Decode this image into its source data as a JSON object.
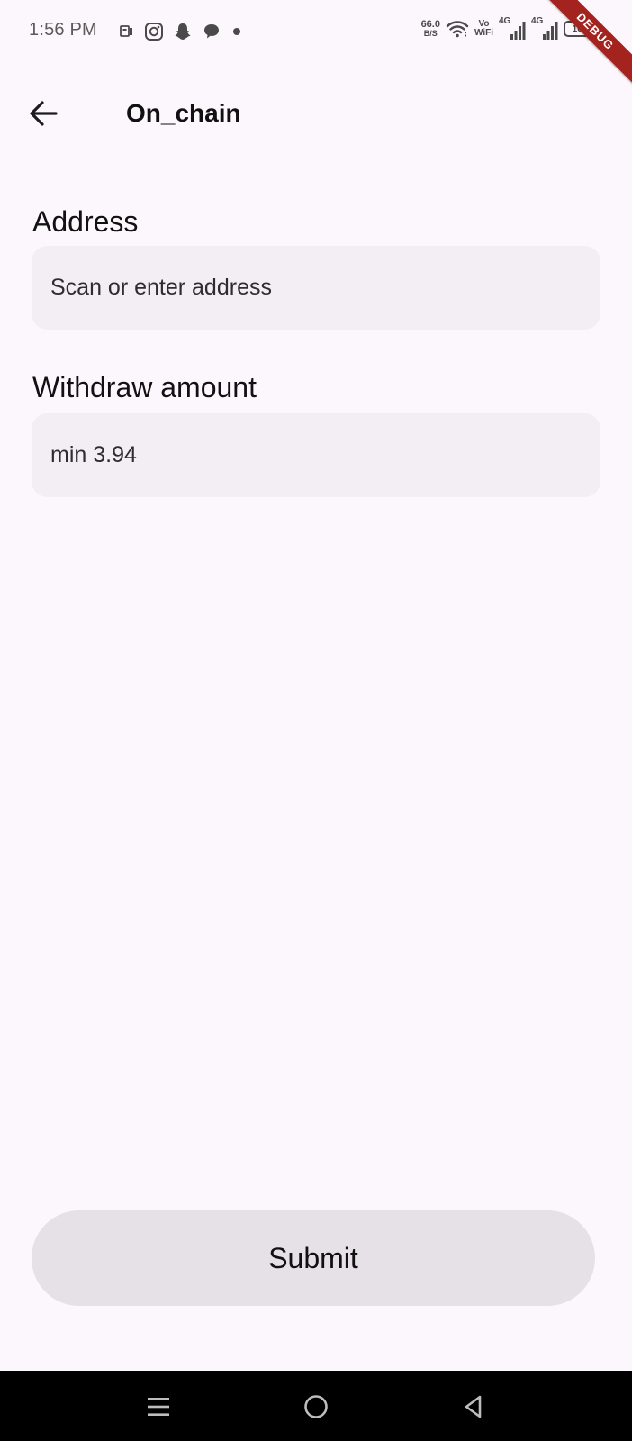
{
  "status_bar": {
    "time": "1:56 PM",
    "net_speed_value": "66.0",
    "net_speed_unit": "B/S",
    "vowifi_top": "Vo",
    "vowifi_bottom": "WiFi",
    "sim1_label": "4G",
    "sim2_label": "4G",
    "battery_level": "100",
    "left_icons": [
      "app-notification-icon",
      "instagram-icon",
      "snapchat-icon",
      "chat-icon",
      "dot-icon"
    ]
  },
  "debug_banner": "DEBUG",
  "app_bar": {
    "title": "On_chain"
  },
  "form": {
    "address": {
      "label": "Address",
      "placeholder": "Scan or enter address",
      "value": ""
    },
    "amount": {
      "label": "Withdraw amount",
      "placeholder": "min 3.94",
      "value": ""
    },
    "submit_label": "Submit"
  },
  "colors": {
    "background": "#fcf7fc",
    "field_fill": "#f3eef4",
    "button_fill": "#e6e0e7",
    "debug_banner": "#a4231f",
    "nav_bar": "#000000"
  }
}
